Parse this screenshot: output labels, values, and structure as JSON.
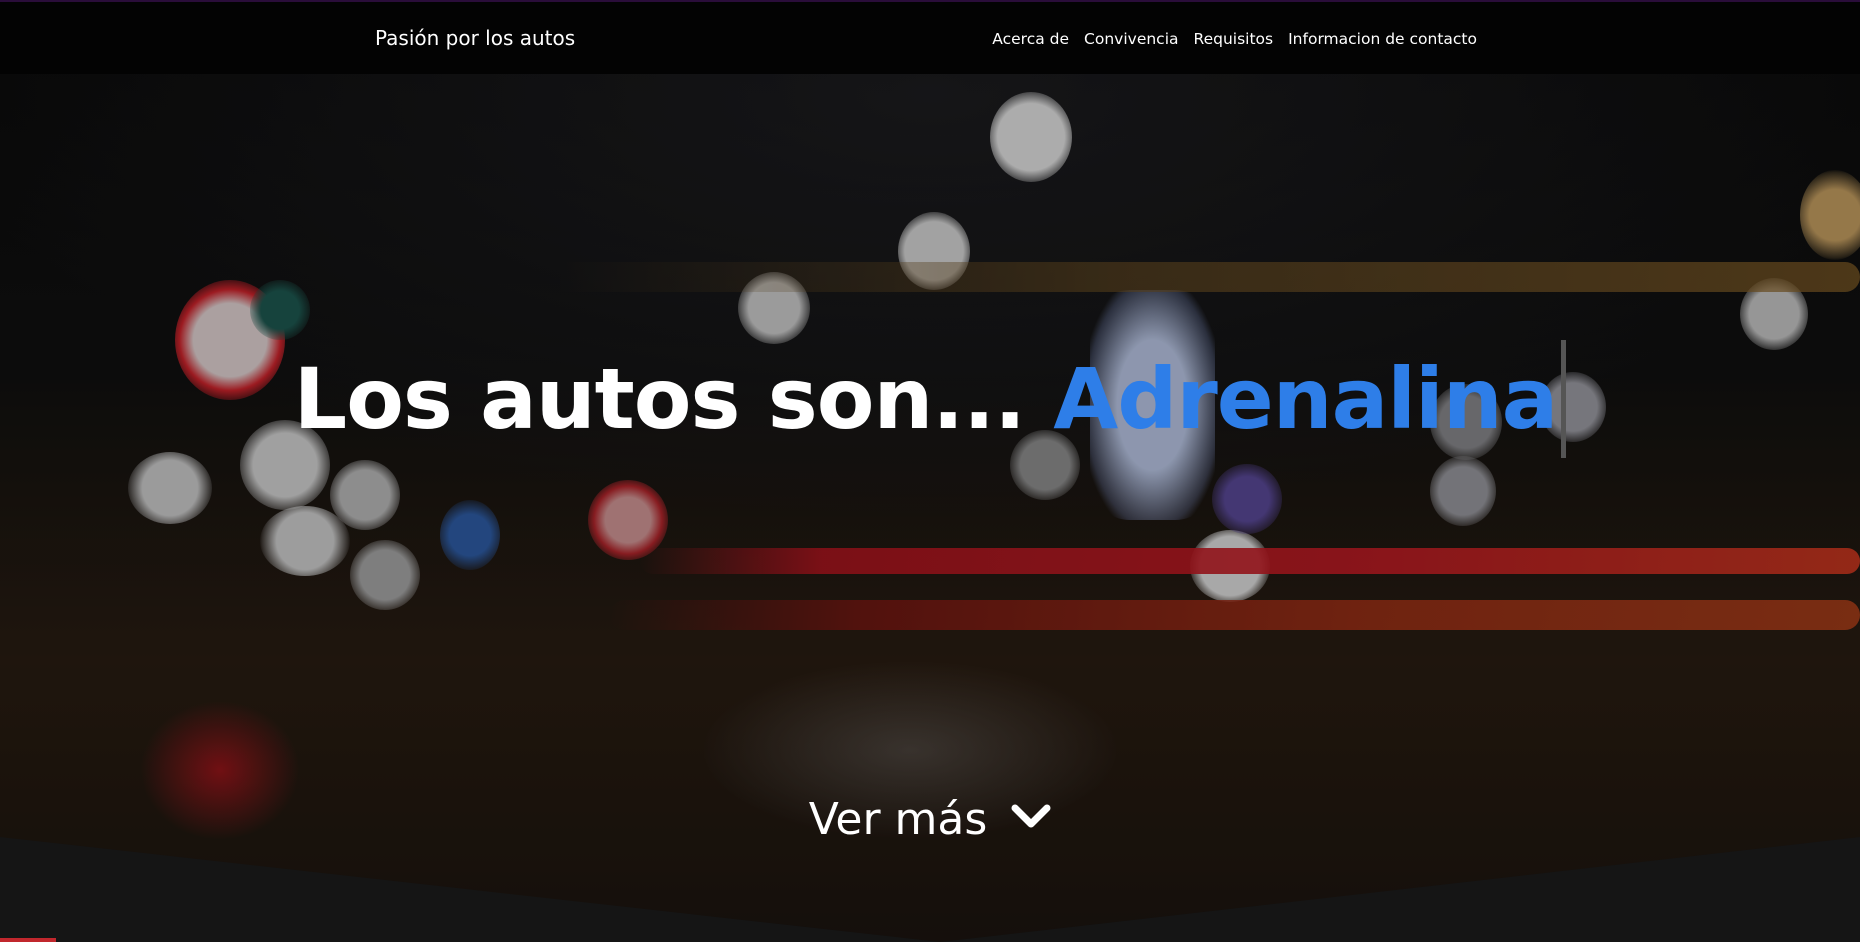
{
  "navbar": {
    "brand": "Pasión por los autos",
    "links": [
      {
        "label": "Acerca de"
      },
      {
        "label": "Convivencia"
      },
      {
        "label": "Requisitos"
      },
      {
        "label": "Informacion de contacto"
      }
    ]
  },
  "hero": {
    "headline_prefix": "Los autos son...",
    "headline_accent": "Adrenalina",
    "see_more_label": "Ver más",
    "see_more_icon": "chevron-down-icon"
  },
  "colors": {
    "accent": "#2e7ee8",
    "navbar_bg": "#030303",
    "bottom_band": "#151515"
  }
}
